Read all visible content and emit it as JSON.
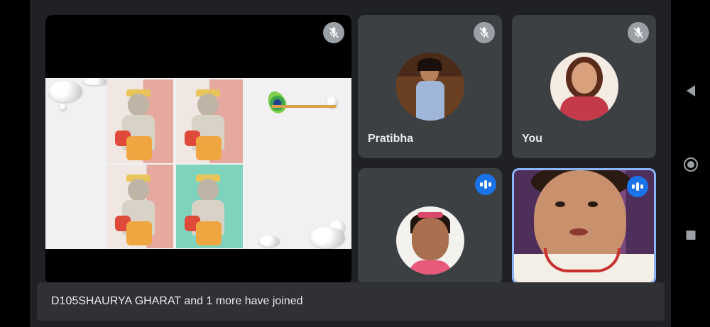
{
  "main_tile": {
    "muted": true,
    "mute_icon": "mic-off-icon"
  },
  "participants": [
    {
      "name": "Pratibha",
      "muted": true,
      "icon": "mic-off-icon"
    },
    {
      "name": "You",
      "muted": true,
      "icon": "mic-off-icon"
    },
    {
      "name": "",
      "speaking": true,
      "icon": "speaking-indicator-icon"
    },
    {
      "name": "",
      "speaking": true,
      "icon": "speaking-indicator-icon",
      "highlighted": true
    }
  ],
  "toast": {
    "message": "D105SHAURYA GHARAT and 1 more have joined"
  },
  "navbar": {
    "back_icon": "back-icon",
    "home_icon": "home-icon",
    "recents_icon": "recents-icon"
  },
  "colors": {
    "background": "#202124",
    "tile": "#3c4043",
    "speaking_blue": "#1a73e8",
    "active_border": "#8ab4f8"
  }
}
